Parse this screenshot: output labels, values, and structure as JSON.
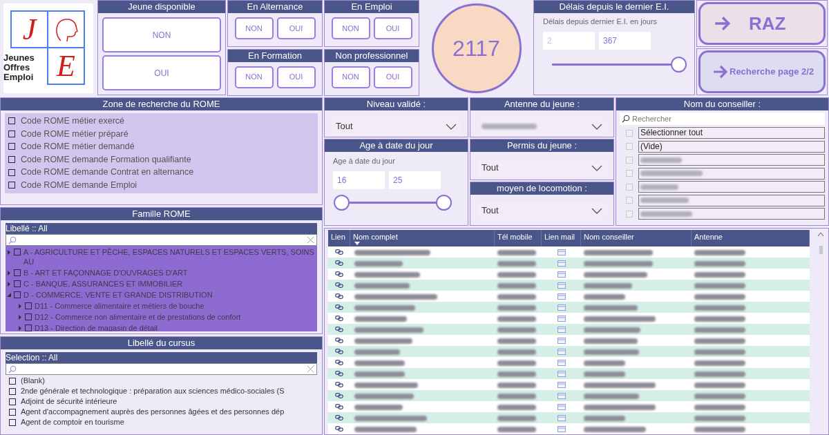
{
  "logo": {
    "letters": [
      "J",
      "E"
    ],
    "words": [
      "Jeunes",
      "Offres",
      "Emploi"
    ]
  },
  "toggle_groups": [
    {
      "kind": "stacked",
      "title": "Jeune disponible",
      "buttons": [
        "NON",
        "OUI"
      ]
    },
    {
      "kind": "row",
      "title": "En Alternance",
      "buttons": [
        "NON",
        "OUI"
      ]
    },
    {
      "kind": "row",
      "title": "En Emploi",
      "buttons": [
        "NON",
        "OUI"
      ]
    },
    {
      "kind": "row",
      "title": "En Formation",
      "buttons": [
        "NON",
        "OUI"
      ]
    },
    {
      "kind": "row",
      "title": "Non professionnel",
      "buttons": [
        "NON",
        "OUI"
      ]
    }
  ],
  "count": "2117",
  "delay_filter": {
    "title": "Délais depuis le dernier E.I.",
    "label": "Délais depuis dernier E.I. en jours",
    "min_placeholder": "2",
    "max_value": "367",
    "level": 1
  },
  "actions": [
    {
      "kind": "large",
      "label": "RAZ"
    },
    {
      "kind": "small",
      "label": "Recherche page 2/2"
    }
  ],
  "rome_zone": {
    "title": "Zone de recherche du ROME",
    "options": [
      {
        "label": "Code ROME métier exercé",
        "checked": false
      },
      {
        "label": "Code ROME métier préparé",
        "checked": false
      },
      {
        "label": "Code ROME métier demandé",
        "checked": false
      },
      {
        "label": "Code ROME demande Formation qualifiante",
        "checked": false
      },
      {
        "label": "Code ROME demande Contrat en alternance",
        "checked": false
      },
      {
        "label": "Code ROME demande Emploi",
        "checked": false
      }
    ]
  },
  "famille_rome": {
    "title": "Famille ROME",
    "filter_label": "Libellé :: All",
    "items": [
      {
        "label": "A - AGRICULTURE ET PÊCHE, ESPACES NATURELS ET ESPACES VERTS, SOINS AU",
        "checked": false,
        "expanded": false
      },
      {
        "label": "B - ART ET FAÇONNAGE D'OUVRAGES D'ART",
        "checked": false,
        "expanded": false
      },
      {
        "label": "C - BANQUE, ASSURANCES ET IMMOBILIER",
        "checked": false,
        "expanded": false
      },
      {
        "label": "D - COMMERCE, VENTE ET GRANDE DISTRIBUTION",
        "checked": false,
        "expanded": true,
        "children": [
          {
            "label": "D11 - Commerce alimentaire et métiers de bouche",
            "checked": false,
            "expanded": false
          },
          {
            "label": "D12 - Commerce non alimentaire et de prestations de confort",
            "checked": false,
            "expanded": false
          },
          {
            "label": "D13 - Direction de magasin de détail",
            "checked": false,
            "expanded": false
          }
        ]
      }
    ]
  },
  "cursus": {
    "title": "Libellé du cursus",
    "filter_label": "Selection :: All",
    "items": [
      {
        "label": "(Blank)",
        "checked": false
      },
      {
        "label": "2nde générale et technologique : préparation aux sciences médico-sociales (S",
        "checked": false
      },
      {
        "label": "Adjoint de sécurité intérieure",
        "checked": false
      },
      {
        "label": "Agent d'accompagnement auprès des personnes âgées et des personnes dép",
        "checked": false
      },
      {
        "label": "Agent de comptoir en tourisme",
        "checked": false
      }
    ]
  },
  "niveau": {
    "title": "Niveau validé :",
    "value": "Tout"
  },
  "age": {
    "title": "Age à date du jour",
    "label": "Age à date du jour",
    "min_value": "16",
    "max_value": "25",
    "thumbs": [
      {
        "level": 0
      },
      {
        "level": 1
      }
    ]
  },
  "antenne": {
    "title": "Antenne du jeune :"
  },
  "permis": {
    "title": "Permis du jeune :",
    "value": "Tout"
  },
  "locomotion": {
    "title": "moyen de locomotion :",
    "value": "Tout"
  },
  "conseiller": {
    "title": "Nom du conseiller :",
    "search_placeholder": "Rechercher",
    "items": [
      {
        "kind": "text",
        "label": "Sélectionner tout",
        "checked": false
      },
      {
        "kind": "text",
        "label": "(Vide)",
        "checked": false
      },
      {
        "kind": "blurred",
        "checked": false
      },
      {
        "kind": "blurred",
        "checked": false
      },
      {
        "kind": "blurred",
        "checked": false
      },
      {
        "kind": "blurred",
        "checked": false
      },
      {
        "kind": "blurred",
        "checked": false
      }
    ]
  },
  "table": {
    "columns": [
      {
        "label": "Lien",
        "sorted": false
      },
      {
        "label": "Nom complet",
        "sorted": true
      },
      {
        "label": "Tél mobile",
        "sorted": false
      },
      {
        "label": "Lien mail",
        "sorted": false
      },
      {
        "label": "Nom conseiller",
        "sorted": false
      },
      {
        "label": "Antenne",
        "sorted": false
      }
    ],
    "rows": [
      {
        "link": true,
        "mail": true
      },
      {
        "link": true,
        "mail": true
      },
      {
        "link": true,
        "mail": true
      },
      {
        "link": true,
        "mail": true
      },
      {
        "link": true,
        "mail": true
      },
      {
        "link": true,
        "mail": true
      },
      {
        "link": true,
        "mail": true
      },
      {
        "link": true,
        "mail": true
      },
      {
        "link": true,
        "mail": true
      },
      {
        "link": true,
        "mail": true
      },
      {
        "link": true,
        "mail": true
      },
      {
        "link": true,
        "mail": true
      },
      {
        "link": true,
        "mail": true
      },
      {
        "link": true,
        "mail": true
      },
      {
        "link": true,
        "mail": true
      },
      {
        "link": true,
        "mail": true
      },
      {
        "link": true,
        "mail": true
      }
    ]
  }
}
